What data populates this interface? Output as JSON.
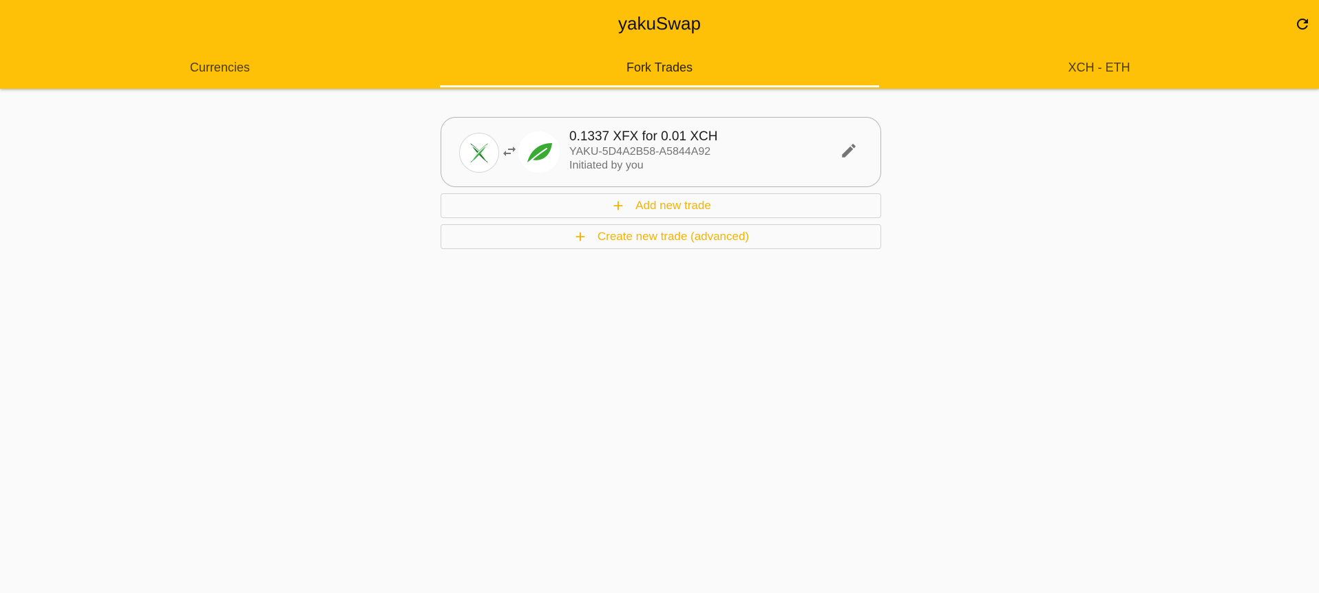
{
  "app": {
    "title": "yakuSwap",
    "accent_color": "#ffc107",
    "refresh_icon": "refresh-icon"
  },
  "tabs": [
    {
      "label": "Currencies",
      "active": false
    },
    {
      "label": "Fork Trades",
      "active": true
    },
    {
      "label": "XCH - ETH",
      "active": false
    }
  ],
  "trades": [
    {
      "title": "0.1337 XFX for 0.01 XCH",
      "id": "YAKU-5D4A2B58-A5844A92",
      "status": "Initiated by you",
      "from_coin_icon": "xfx-logo-icon",
      "to_coin_icon": "xch-leaf-icon",
      "swap_icon": "swap-arrows-icon",
      "edit_icon": "pencil-icon"
    }
  ],
  "actions": {
    "add_trade_label": "Add new trade",
    "create_advanced_label": "Create new trade (advanced)",
    "button_color": "#f4b400"
  }
}
